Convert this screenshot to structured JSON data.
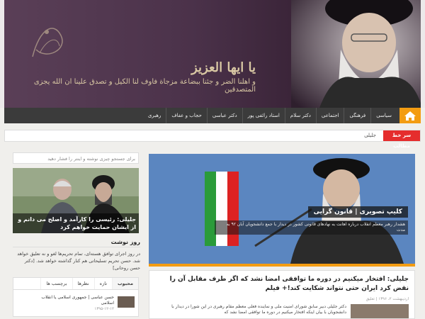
{
  "header": {
    "calligraphy_title": "یا ایها العزیز",
    "calligraphy_line": "و اهلنا الضر و جئنا ببضاعة مزجاة فاوف لنا الکیل و تصدق علینا ان الله یجزی المتصدقین"
  },
  "nav": {
    "home_icon": "home-icon",
    "items": [
      "سیاسی",
      "فرهنگی",
      "اجتماعی",
      "دکتر سلام",
      "استاد رائفی پور",
      "دکتر عباسی",
      "حجاب و عفاف",
      "رهبری"
    ]
  },
  "ticker": {
    "label": "سر خط مطالب",
    "item": "جلیلی"
  },
  "sidebar": {
    "search_placeholder": "برای جستجو چیزی نوشته و اینتر را فشار دهید",
    "featured_caption": "جلیلی: رئیسی را کارآمد و اصلح می دانم و از ایشان حمایت خواهم کرد",
    "quote_title": "روز نوشت",
    "quote_text": "در روز اجرای توافق هسته‌ای، تمام تحریم‌ها لغو و نه تعلیق خواهد شد. حسن تحریم تسلیحاتی هم کنار گذاشته خواهد شد. [دکتر حسن روحانی]",
    "tabs": [
      "محبوب",
      "تازه",
      "نظرها",
      "برچسب ها"
    ],
    "tab_entry_title": "حسن عباسی | جمهوری اسلامی یا انقلاب اسلامی",
    "tab_entry_date": "۱۳۹۵-۱۲-۱۲"
  },
  "feature": {
    "tag": "کلیپ تصویری | قانون گرایی",
    "description": "هشدار رهبر معظم انقلاب درباره اهانت به نهادهای قانونی کشور در دیدار با جمع دانشجویان آبان ۹۲ به مدت"
  },
  "article": {
    "title": "جلیلی: افتخار میکنیم در دوره ما توافقی امضا نشد که اگر طرف مقابل آن را نقض کرد ایران حتی نتواند شکایت کند!+ فیلم",
    "meta": "اردیبهشت ۲، ۱۳۹۶ | تعلیق",
    "body": "دکتر جلیلی دبیر سابق شورای امنیت ملی و نماینده فعلی معظم مقام رهبری در این شورا در دیدار با دانشجویان با بیان اینکه افتخار میکنیم در دوره ما توافقی امضا نشد که"
  }
}
